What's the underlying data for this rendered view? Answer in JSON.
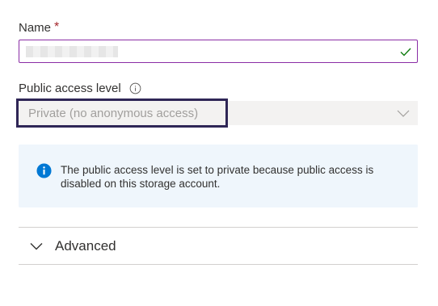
{
  "name_field": {
    "label": "Name",
    "required_marker": "*",
    "value": "",
    "border_color": "#8a2da5",
    "valid_icon": "check-icon"
  },
  "access_field": {
    "label": "Public access level",
    "info_icon": "info-circle-icon",
    "selected_value": "Private (no anonymous access)",
    "disabled": true,
    "dropdown_icon": "chevron-down-icon"
  },
  "info_message": {
    "icon": "info-solid-icon",
    "text": "The public access level is set to private because public access is disabled on this storage account.",
    "background": "#eff6fc",
    "icon_color": "#0078d4"
  },
  "advanced_section": {
    "label": "Advanced",
    "expanded": false,
    "icon": "chevron-down-icon"
  }
}
